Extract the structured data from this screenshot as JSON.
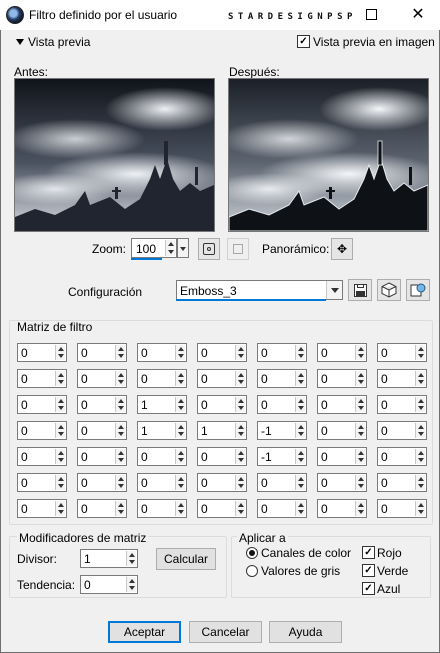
{
  "window": {
    "title": "Filtro definido por el usuario",
    "watermark": "STARDESIGNPSP",
    "close_glyph": "✕"
  },
  "preview": {
    "toggle_label": "Vista previa",
    "image_preview_label": "Vista previa en imagen",
    "image_preview_checked": true,
    "before_label": "Antes:",
    "after_label": "Después:",
    "zoom_label": "Zoom:",
    "zoom_value": "100",
    "pan_label": "Panorámico:"
  },
  "config": {
    "label": "Configuración",
    "value": "Emboss_3"
  },
  "matrix": {
    "title": "Matriz de filtro",
    "rows": [
      [
        "0",
        "0",
        "0",
        "0",
        "0",
        "0",
        "0"
      ],
      [
        "0",
        "0",
        "0",
        "0",
        "0",
        "0",
        "0"
      ],
      [
        "0",
        "0",
        "1",
        "0",
        "0",
        "0",
        "0"
      ],
      [
        "0",
        "0",
        "1",
        "1",
        "-1",
        "0",
        "0"
      ],
      [
        "0",
        "0",
        "0",
        "0",
        "-1",
        "0",
        "0"
      ],
      [
        "0",
        "0",
        "0",
        "0",
        "0",
        "0",
        "0"
      ],
      [
        "0",
        "0",
        "0",
        "0",
        "0",
        "0",
        "0"
      ]
    ]
  },
  "modifiers": {
    "title": "Modificadores de matriz",
    "divisor_label": "Divisor:",
    "divisor_value": "1",
    "bias_label": "Tendencia:",
    "bias_value": "0",
    "calculate_label": "Calcular"
  },
  "apply": {
    "title": "Aplicar a",
    "color_channels_label": "Canales de color",
    "grayscale_label": "Valores de gris",
    "selected": "color_channels",
    "red_label": "Rojo",
    "green_label": "Verde",
    "blue_label": "Azul",
    "red_checked": true,
    "green_checked": true,
    "blue_checked": true
  },
  "footer": {
    "ok_label": "Aceptar",
    "cancel_label": "Cancelar",
    "help_label": "Ayuda"
  },
  "colors": {
    "accent": "#0078d7",
    "dialog_bg": "#f0f0f0"
  },
  "icons": [
    "app-icon",
    "maximize-icon",
    "close-icon",
    "triangle-down-icon",
    "checkbox-icon",
    "zoom-fit-icon",
    "proof-icon",
    "move-icon",
    "save-icon",
    "randomize-icon",
    "reset-icon",
    "spin-arrows-icon"
  ]
}
